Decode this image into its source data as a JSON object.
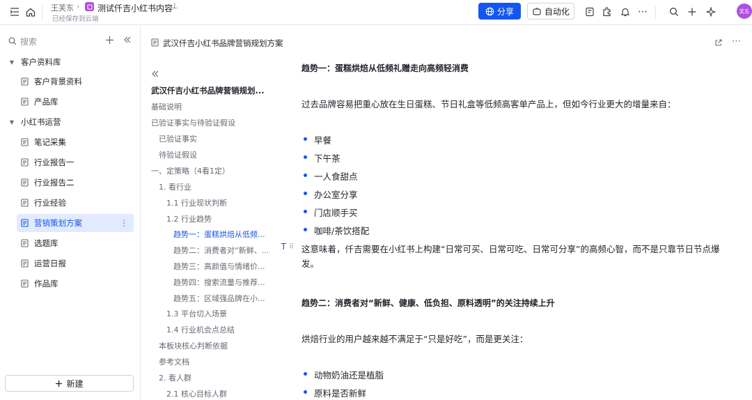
{
  "topbar": {
    "user": "王芙东",
    "workspace_title": "测试仟吉小红书内容",
    "save_status": "已经保存到云端",
    "share_label": "分享",
    "automation_label": "自动化",
    "avatar_text": "芙东"
  },
  "sidebar": {
    "search_placeholder": "搜索",
    "groups": [
      {
        "label": "客户资料库",
        "children": [
          "客户背景资料",
          "产品库"
        ]
      },
      {
        "label": "小红书运营",
        "children": [
          "笔记采集",
          "行业报告一",
          "行业报告二",
          "行业经验",
          "营销策划方案",
          "选题库",
          "运营日报",
          "作品库"
        ]
      }
    ],
    "active_item": "营销策划方案",
    "new_label": "新建"
  },
  "doc": {
    "title": "武汉仟吉小红书品牌营销规划方案"
  },
  "outline": [
    {
      "text": "武汉仟吉小红书品牌营销规划...",
      "level": 0
    },
    {
      "text": "基础说明",
      "level": 0
    },
    {
      "text": "已验证事实与待验证假设",
      "level": 0
    },
    {
      "text": "已验证事实",
      "level": 1
    },
    {
      "text": "待验证假设",
      "level": 1
    },
    {
      "text": "一、定策略（4看1定）",
      "level": 0
    },
    {
      "text": "1. 看行业",
      "level": 1
    },
    {
      "text": "1.1 行业现状判断",
      "level": 2
    },
    {
      "text": "1.2 行业趋势",
      "level": 2
    },
    {
      "text": "趋势一：蛋糕烘焙从低频...",
      "level": 3
    },
    {
      "text": "趋势二：消费者对“新鲜、...",
      "level": 3
    },
    {
      "text": "趋势三：高颜值与情绪价...",
      "level": 3
    },
    {
      "text": "趋势四：搜索流量与推荐...",
      "level": 3
    },
    {
      "text": "趋势五：区域强品牌在小...",
      "level": 3
    },
    {
      "text": "1.3 平台切入场景",
      "level": 2
    },
    {
      "text": "1.4 行业机会点总结",
      "level": 2
    },
    {
      "text": "本板块核心判断依据",
      "level": 1
    },
    {
      "text": "参考文档",
      "level": 1
    },
    {
      "text": "2. 看人群",
      "level": 1
    },
    {
      "text": "2.1 核心目标人群",
      "level": 2
    }
  ],
  "content": {
    "trend1_heading": "趋势一：蛋糕烘焙从低频礼赠走向高频轻消费",
    "trend1_intro": "过去品牌容易把重心放在生日蛋糕、节日礼盒等低频高客单产品上，但如今行业更大的增量来自：",
    "trend1_bullets": [
      "早餐",
      "下午茶",
      "一人食甜点",
      "办公室分享",
      "门店顺手买",
      "咖啡/茶饮搭配"
    ],
    "trend1_conclusion_line1": "这意味着，仟吉需要在小红书上构建“日常可买、日常可吃、日常可分享”的高频心智，而不是只靠节日节点爆",
    "trend1_conclusion_line2": "发。",
    "trend2_heading": "趋势二：消费者对“新鲜、健康、低负担、原料透明”的关注持续上升",
    "trend2_intro": "烘焙行业的用户越来越不满足于“只是好吃”，而是更关注：",
    "trend2_bullets": [
      "动物奶油还是植脂",
      "原料是否新鲜"
    ]
  },
  "colors": {
    "accent": "#1456f0",
    "active_bg": "#e1eaff",
    "avatar": "#b04fe0"
  }
}
